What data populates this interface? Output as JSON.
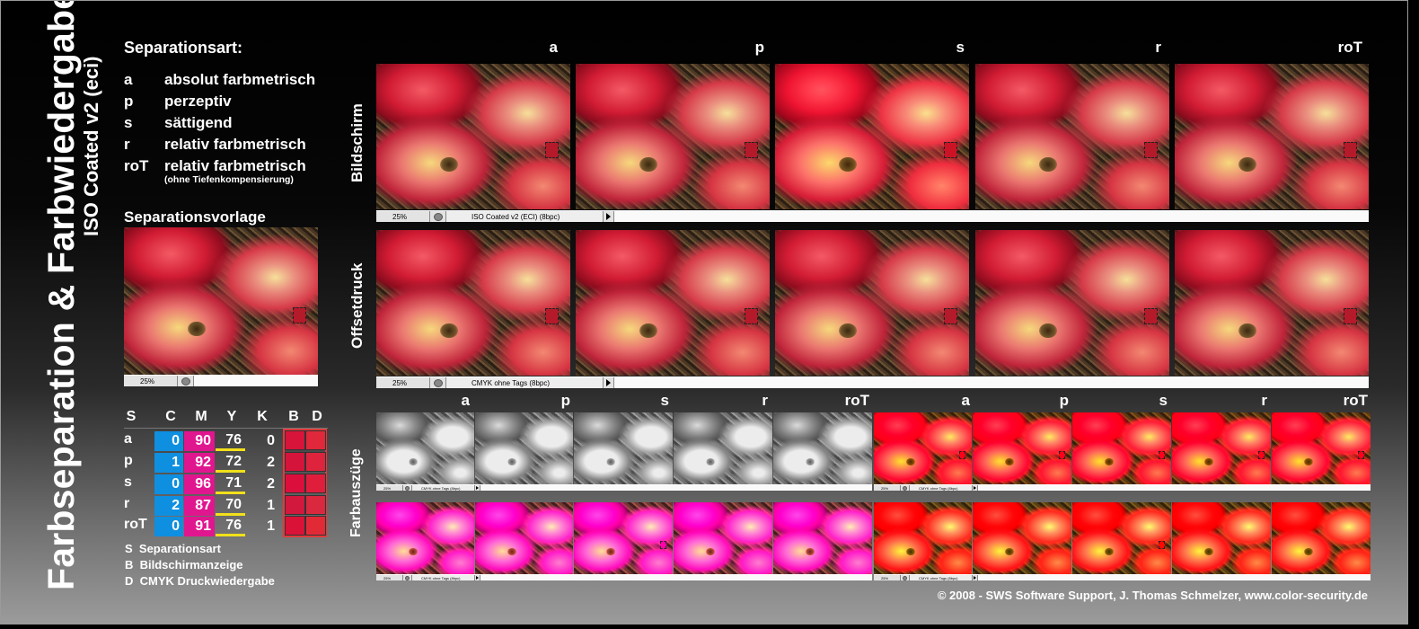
{
  "title": "Farbseparation & Farbwiedergabe",
  "subtitle": "ISO Coated v2 (eci)",
  "legend": {
    "heading": "Separationsart:",
    "items": [
      {
        "key": "a",
        "text": "absolut farbmetrisch"
      },
      {
        "key": "p",
        "text": "perzeptiv"
      },
      {
        "key": "s",
        "text": "sättigend"
      },
      {
        "key": "r",
        "text": "relativ farbmetrisch"
      },
      {
        "key": "roT",
        "text": "relativ farbmetrisch"
      }
    ],
    "note": "(ohne Tiefenkompensierung)"
  },
  "vorlage": {
    "heading": "Separationsvorlage",
    "zoom": "25%"
  },
  "columns": [
    "a",
    "p",
    "s",
    "r",
    "roT"
  ],
  "rows": {
    "bildschirm": {
      "label": "Bildschirm",
      "zoom": "25%",
      "profile": "ISO Coated v2 (ECI) (8bpc)"
    },
    "offsetdruck": {
      "label": "Offsetdruck",
      "zoom": "25%",
      "profile": "CMYK ohne Tags (8bpc)"
    },
    "farbauszuege": {
      "label": "Farbauszüge",
      "zoom": "25%",
      "profile": "CMYK ohne Tags (8bpc)"
    }
  },
  "table": {
    "headers": [
      "S",
      "C",
      "M",
      "Y",
      "K",
      "B",
      "D"
    ],
    "rows": [
      {
        "s": "a",
        "c": "0",
        "m": "90",
        "y": "76",
        "k": "0",
        "b_color": "#d8143a",
        "d_color": "#e0283a"
      },
      {
        "s": "p",
        "c": "1",
        "m": "92",
        "y": "72",
        "k": "2",
        "b_color": "#d5143c",
        "d_color": "#dd243c"
      },
      {
        "s": "s",
        "c": "0",
        "m": "96",
        "y": "71",
        "k": "2",
        "b_color": "#dc0e3c",
        "d_color": "#e01e3c"
      },
      {
        "s": "r",
        "c": "2",
        "m": "87",
        "y": "70",
        "k": "1",
        "b_color": "#d3183e",
        "d_color": "#da283e"
      },
      {
        "s": "roT",
        "c": "0",
        "m": "91",
        "y": "76",
        "k": "1",
        "b_color": "#da1238",
        "d_color": "#e22a36"
      }
    ]
  },
  "footnotes": [
    {
      "key": "S",
      "text": "Separationsart"
    },
    {
      "key": "B",
      "text": "Bildschirmanzeige"
    },
    {
      "key": "D",
      "text": "CMYK Druckwiedergabe"
    }
  ],
  "copyright": "© 2008 - SWS Software Support, J. Thomas Schmelzer, www.color-security.de"
}
